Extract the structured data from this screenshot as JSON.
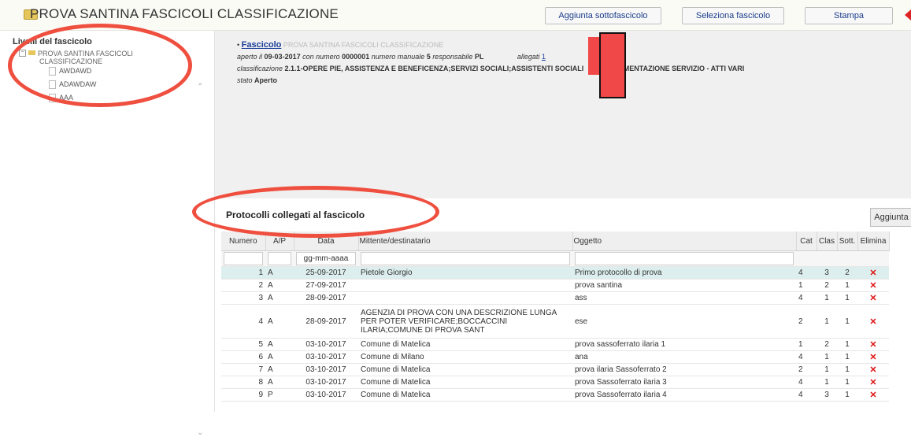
{
  "header": {
    "title": "PROVA SANTINA FASCICOLI CLASSIFICAZIONE",
    "buttons": {
      "add_subfolder": "Aggiunta sottofascicolo",
      "select_folder": "Seleziona fascicolo",
      "print": "Stampa"
    }
  },
  "sidebar": {
    "heading": "Livelli del fascicolo",
    "root_line1": "PROVA SANTINA FASCICOLI",
    "root_line2": "CLASSIFICAZIONE",
    "items": [
      "AWDAWD",
      "ADAWDAW",
      "AAA"
    ]
  },
  "detail": {
    "link": "Fascicolo",
    "name": "PROVA SANTINA FASCICOLI CLASSIFICAZIONE",
    "opened_label": "aperto il",
    "opened_date": "09-03-2017",
    "number_label": "con numero",
    "number": "0000001",
    "manual_label": "numero manuale",
    "manual": "5",
    "resp_label": "responsabile",
    "resp": "PL",
    "attach_label": "allegati",
    "attach": "1",
    "class_label": "classificazione",
    "class_value": "2.1.1-OPERE PIE, ASSISTENZA E BENEFICENZA;SERVIZI SOCIALI;ASSISTENTI SOCIALI",
    "class_tail": "MENTAZIONE SERVIZIO - ATTI VARI",
    "state_label": "stato",
    "state": "Aperto"
  },
  "protocols": {
    "title": "Protocolli collegati al fascicolo",
    "add_button": "Aggiunta",
    "columns": [
      "Numero",
      "A/P",
      "Data",
      "Mittente/destinatario",
      "Oggetto",
      "Cat",
      "Clas",
      "Sott.",
      "Elimina"
    ],
    "date_placeholder": "gg-mm-aaaa",
    "rows": [
      {
        "num": "1",
        "ap": "A",
        "date": "25-09-2017",
        "sender": "Pietole Giorgio",
        "subject": "Primo protocollo di prova",
        "cat": "4",
        "clas": "3",
        "sott": "2"
      },
      {
        "num": "2",
        "ap": "A",
        "date": "27-09-2017",
        "sender": "",
        "subject": "prova santina",
        "cat": "1",
        "clas": "2",
        "sott": "1"
      },
      {
        "num": "3",
        "ap": "A",
        "date": "28-09-2017",
        "sender": "",
        "subject": "ass",
        "cat": "4",
        "clas": "1",
        "sott": "1"
      },
      {
        "num": "4",
        "ap": "A",
        "date": "28-09-2017",
        "sender": "AGENZIA DI PROVA CON UNA DESCRIZIONE LUNGA PER POTER VERIFICARE;BOCCACCINI ILARIA;COMUNE DI PROVA SANT",
        "subject": "ese",
        "cat": "2",
        "clas": "1",
        "sott": "1"
      },
      {
        "num": "5",
        "ap": "A",
        "date": "03-10-2017",
        "sender": "Comune di Matelica",
        "subject": "prova sassoferrato ilaria 1",
        "cat": "1",
        "clas": "2",
        "sott": "1"
      },
      {
        "num": "6",
        "ap": "A",
        "date": "03-10-2017",
        "sender": "Comune di Milano",
        "subject": "ana",
        "cat": "4",
        "clas": "1",
        "sott": "1"
      },
      {
        "num": "7",
        "ap": "A",
        "date": "03-10-2017",
        "sender": "Comune di Matelica",
        "subject": "prova ilaria Sassoferrato 2",
        "cat": "2",
        "clas": "1",
        "sott": "1"
      },
      {
        "num": "8",
        "ap": "A",
        "date": "03-10-2017",
        "sender": "Comune di Matelica",
        "subject": "prova Sassoferrato ilaria 3",
        "cat": "4",
        "clas": "1",
        "sott": "1"
      },
      {
        "num": "9",
        "ap": "P",
        "date": "03-10-2017",
        "sender": "Comune di Matelica",
        "subject": "prova Sassoferrato ilaria 4",
        "cat": "4",
        "clas": "3",
        "sott": "1"
      }
    ]
  },
  "icons": {
    "delete": "✕",
    "scroll_up": "⌃",
    "scroll_down": "⌄"
  },
  "colors": {
    "annotation": "#ef4f3f",
    "delete": "#dd1111",
    "link": "#1a3d9a"
  }
}
